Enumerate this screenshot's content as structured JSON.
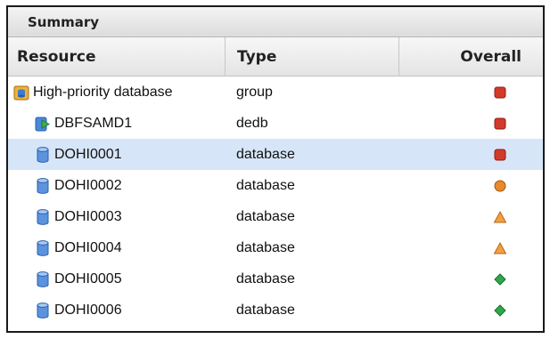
{
  "panel": {
    "title": "Summary"
  },
  "columns": {
    "resource": "Resource",
    "type": "Type",
    "overall": "Overall"
  },
  "rows": [
    {
      "name": "High-priority database",
      "type": "group",
      "icon": "group-database-icon",
      "status": "critical-square",
      "level": 0
    },
    {
      "name": "DBFSAMD1",
      "type": "dedb",
      "icon": "dedb-icon",
      "status": "critical-square",
      "level": 1
    },
    {
      "name": "DOHI0001",
      "type": "database",
      "icon": "database-icon",
      "status": "critical-square",
      "level": 1,
      "selected": true
    },
    {
      "name": "DOHI0002",
      "type": "database",
      "icon": "database-icon",
      "status": "warning-circle",
      "level": 1
    },
    {
      "name": "DOHI0003",
      "type": "database",
      "icon": "database-icon",
      "status": "caution-triangle",
      "level": 1
    },
    {
      "name": "DOHI0004",
      "type": "database",
      "icon": "database-icon",
      "status": "caution-triangle",
      "level": 1
    },
    {
      "name": "DOHI0005",
      "type": "database",
      "icon": "database-icon",
      "status": "normal-diamond",
      "level": 1
    },
    {
      "name": "DOHI0006",
      "type": "database",
      "icon": "database-icon",
      "status": "normal-diamond",
      "level": 1
    }
  ],
  "colors": {
    "critical": "#d23a2a",
    "warning": "#e8892a",
    "caution": "#f0a040",
    "normal": "#2fa84a",
    "selected_row": "#d6e6f8"
  }
}
